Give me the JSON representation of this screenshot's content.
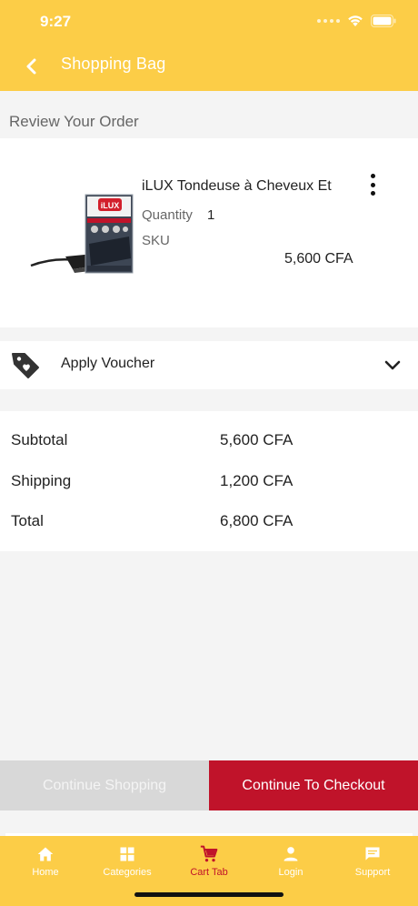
{
  "status_bar": {
    "time": "9:27"
  },
  "nav": {
    "title": "Shopping Bag"
  },
  "review": {
    "title": "Review Your Order"
  },
  "cart_item": {
    "name": "iLUX Tondeuse à Cheveux Et",
    "quantity_label": "Quantity",
    "quantity": "1",
    "sku_label": "SKU",
    "price": "5,600 CFA",
    "image_text": "iLUX"
  },
  "voucher": {
    "label": "Apply Voucher"
  },
  "totals": {
    "rows": [
      {
        "label": "Subtotal",
        "value": "5,600 CFA"
      },
      {
        "label": "Shipping",
        "value": "1,200 CFA"
      },
      {
        "label": "Total",
        "value": "6,800 CFA"
      }
    ]
  },
  "buttons": {
    "continue_shopping": "Continue Shopping",
    "checkout": "Continue To Checkout"
  },
  "tabs": [
    {
      "label": "Home",
      "icon": "home-icon",
      "active": false
    },
    {
      "label": "Categories",
      "icon": "grid-icon",
      "active": false
    },
    {
      "label": "Cart Tab",
      "icon": "cart-icon",
      "active": true
    },
    {
      "label": "Login",
      "icon": "user-icon",
      "active": false
    },
    {
      "label": "Support",
      "icon": "chat-icon",
      "active": false
    }
  ],
  "colors": {
    "brand_yellow": "#fccd47",
    "accent_red": "#c0132a",
    "muted_gray": "#d8d8d8"
  }
}
